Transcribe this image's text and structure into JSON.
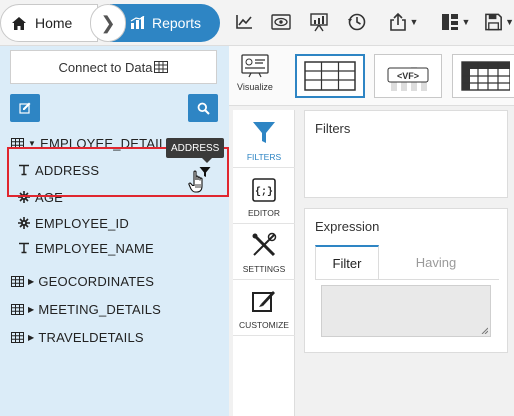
{
  "breadcrumb": {
    "home_label": "Home",
    "separator": "❯",
    "reports_label": "Reports"
  },
  "toolbar": {
    "icons": [
      "line-chart-icon",
      "preview-eye-icon",
      "presentation-icon",
      "history-icon",
      "export-icon",
      "layout-icon",
      "save-icon"
    ]
  },
  "left_panel": {
    "connect_label": "Connect to Data",
    "edit_icon": "edit-icon",
    "search_icon": "search-icon",
    "tables": [
      {
        "name": "EMPLOYEE_DETAILS",
        "expanded": true,
        "fields": [
          {
            "name": "ADDRESS",
            "type": "text"
          },
          {
            "name": "AGE",
            "type": "numeric"
          },
          {
            "name": "EMPLOYEE_ID",
            "type": "numeric"
          },
          {
            "name": "EMPLOYEE_NAME",
            "type": "text"
          }
        ]
      },
      {
        "name": "GEOCORDINATES",
        "expanded": false
      },
      {
        "name": "MEETING_DETAILS",
        "expanded": false
      },
      {
        "name": "TRAVELDETAILS",
        "expanded": false
      }
    ],
    "tooltip": "ADDRESS"
  },
  "viz_bar": {
    "visualize_label": "Visualize",
    "vf_label": "<VF>"
  },
  "side_tabs": [
    {
      "label": "FILTERS",
      "icon": "funnel-icon",
      "active": true
    },
    {
      "label": "EDITOR",
      "icon": "code-braces-icon",
      "active": false
    },
    {
      "label": "SETTINGS",
      "icon": "tools-icon",
      "active": false
    },
    {
      "label": "CUSTOMIZE",
      "icon": "customize-brush-icon",
      "active": false
    }
  ],
  "filters_panel": {
    "title": "Filters"
  },
  "expression_panel": {
    "title": "Expression",
    "tabs": [
      "Filter",
      "Having"
    ],
    "active_tab": "Filter",
    "value": ""
  },
  "colors": {
    "accent": "#2e85c4",
    "left_bg": "#dbecf8",
    "highlight": "#e0262f",
    "tooltip_bg": "#3a3a3a"
  }
}
